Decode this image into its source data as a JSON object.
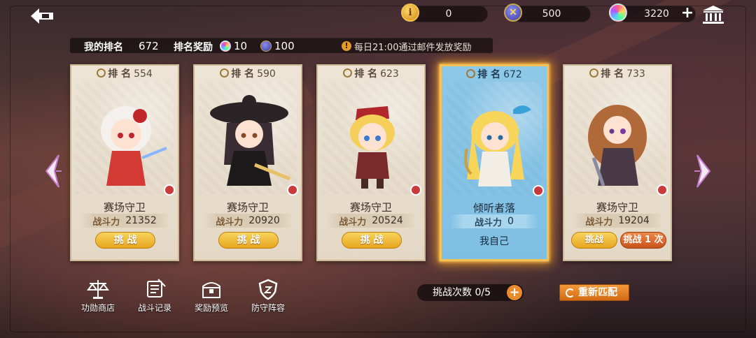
{
  "resources": {
    "honor": {
      "icon": "honor-coin-icon",
      "value": "0"
    },
    "sword": {
      "icon": "arena-token-icon",
      "value": "500"
    },
    "gem": {
      "icon": "rainbow-gem-icon",
      "value": "3220"
    }
  },
  "info": {
    "my_rank_label": "我的排名",
    "my_rank_value": "672",
    "reward_label": "排名奖励",
    "reward_gem": "10",
    "reward_token": "100",
    "notice": "每日21:00通过邮件发放奖励"
  },
  "cards": [
    {
      "rank_label": "排 名",
      "rank": "554",
      "name": "赛场守卫",
      "power_label": "战斗力",
      "power": "21352",
      "button": "挑 战"
    },
    {
      "rank_label": "排 名",
      "rank": "590",
      "name": "赛场守卫",
      "power_label": "战斗力",
      "power": "20920",
      "button": "挑 战"
    },
    {
      "rank_label": "排 名",
      "rank": "623",
      "name": "赛场守卫",
      "power_label": "战斗力",
      "power": "20524",
      "button": "挑 战"
    },
    {
      "rank_label": "排 名",
      "rank": "672",
      "name": "倾听者落",
      "power_label": "战斗力",
      "power": "0",
      "self_label": "我自己"
    },
    {
      "rank_label": "排 名",
      "rank": "733",
      "name": "赛场守卫",
      "power_label": "战斗力",
      "power": "19204",
      "button": "挑战",
      "button2": "挑战 1 次"
    }
  ],
  "bottom": {
    "shop": "功勋商店",
    "records": "战斗记录",
    "rewards": "奖励预览",
    "defense": "防守阵容",
    "challenge_count": "挑战次数 0/5",
    "rematch": "重新匹配"
  },
  "colors": {
    "accent_gold": "#f0b42a",
    "self_card_blue": "#8ec8e8",
    "button_orange": "#d26a14"
  }
}
